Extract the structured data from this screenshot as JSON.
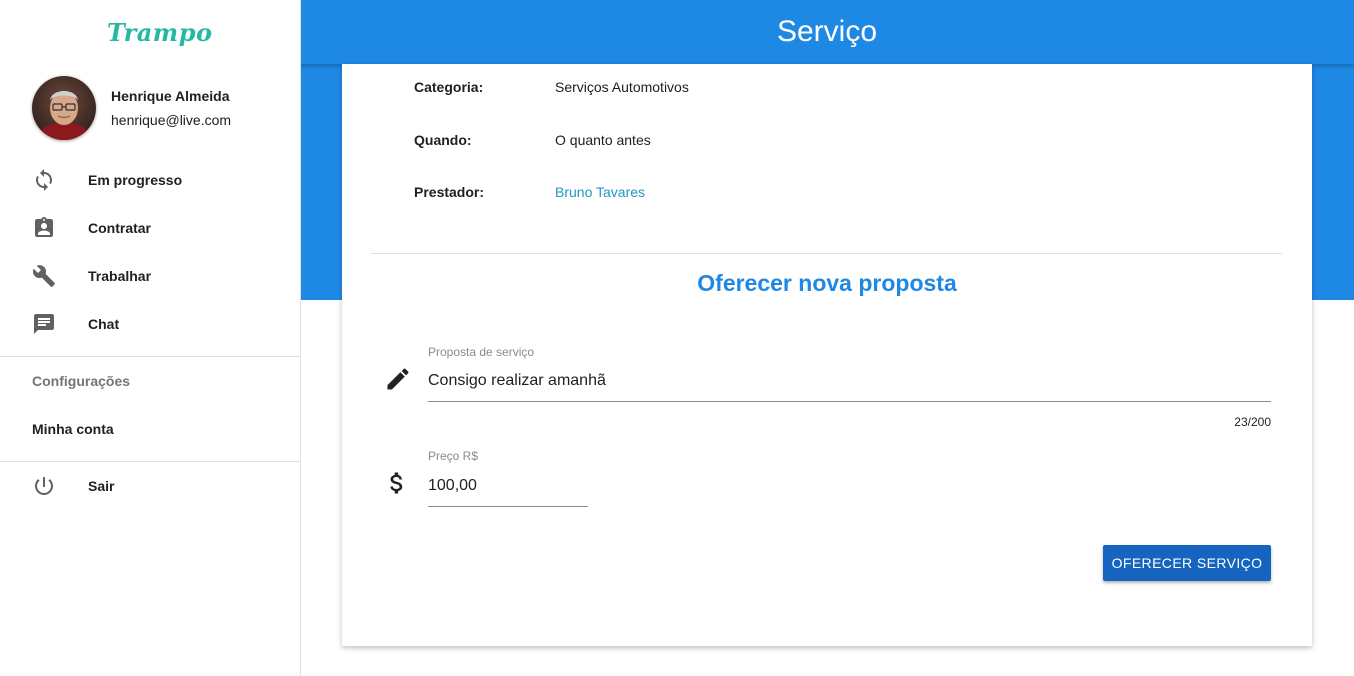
{
  "app": {
    "logo": "Trampo",
    "title": "Serviço"
  },
  "user": {
    "name": "Henrique Almeida",
    "email": "henrique@live.com"
  },
  "nav": {
    "items": [
      {
        "label": "Em progresso",
        "icon": "sync-icon"
      },
      {
        "label": "Contratar",
        "icon": "assignment-ind-icon"
      },
      {
        "label": "Trabalhar",
        "icon": "wrench-icon"
      },
      {
        "label": "Chat",
        "icon": "chat-icon"
      }
    ],
    "settings_header": "Configurações",
    "my_account": "Minha conta",
    "logout": {
      "label": "Sair",
      "icon": "power-icon"
    }
  },
  "service": {
    "rows": [
      {
        "label": "Categoria:",
        "value": "Serviços Automotivos"
      },
      {
        "label": "Quando:",
        "value": "O quanto antes"
      },
      {
        "label": "Prestador:",
        "value": "Bruno Tavares"
      }
    ]
  },
  "proposal": {
    "title": "Oferecer nova proposta",
    "description": {
      "label": "Proposta de serviço",
      "value": "Consigo realizar amanhã",
      "counter": "23/200",
      "icon": "pencil-icon"
    },
    "price": {
      "label": "Preço R$",
      "value": "100,00",
      "icon": "dollar-icon"
    },
    "submit_label": "Oferecer serviço"
  },
  "colors": {
    "primary": "#1e88e5",
    "button": "#1565c0",
    "link": "#2196c4",
    "logo": "#26b8a2"
  }
}
